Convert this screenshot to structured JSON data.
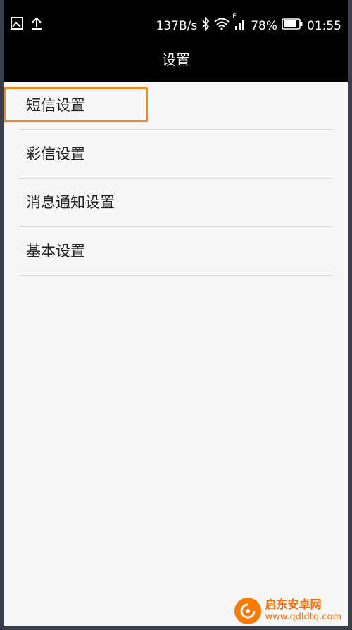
{
  "status_bar": {
    "speed": "137B/s",
    "network": "E",
    "battery": "78%",
    "time": "01:55"
  },
  "header": {
    "title": "设置"
  },
  "settings_list": [
    {
      "label": "短信设置"
    },
    {
      "label": "彩信设置"
    },
    {
      "label": "消息通知设置"
    },
    {
      "label": "基本设置"
    }
  ],
  "watermark": {
    "title": "启东安卓网",
    "url": "www.qdldtq.com"
  }
}
